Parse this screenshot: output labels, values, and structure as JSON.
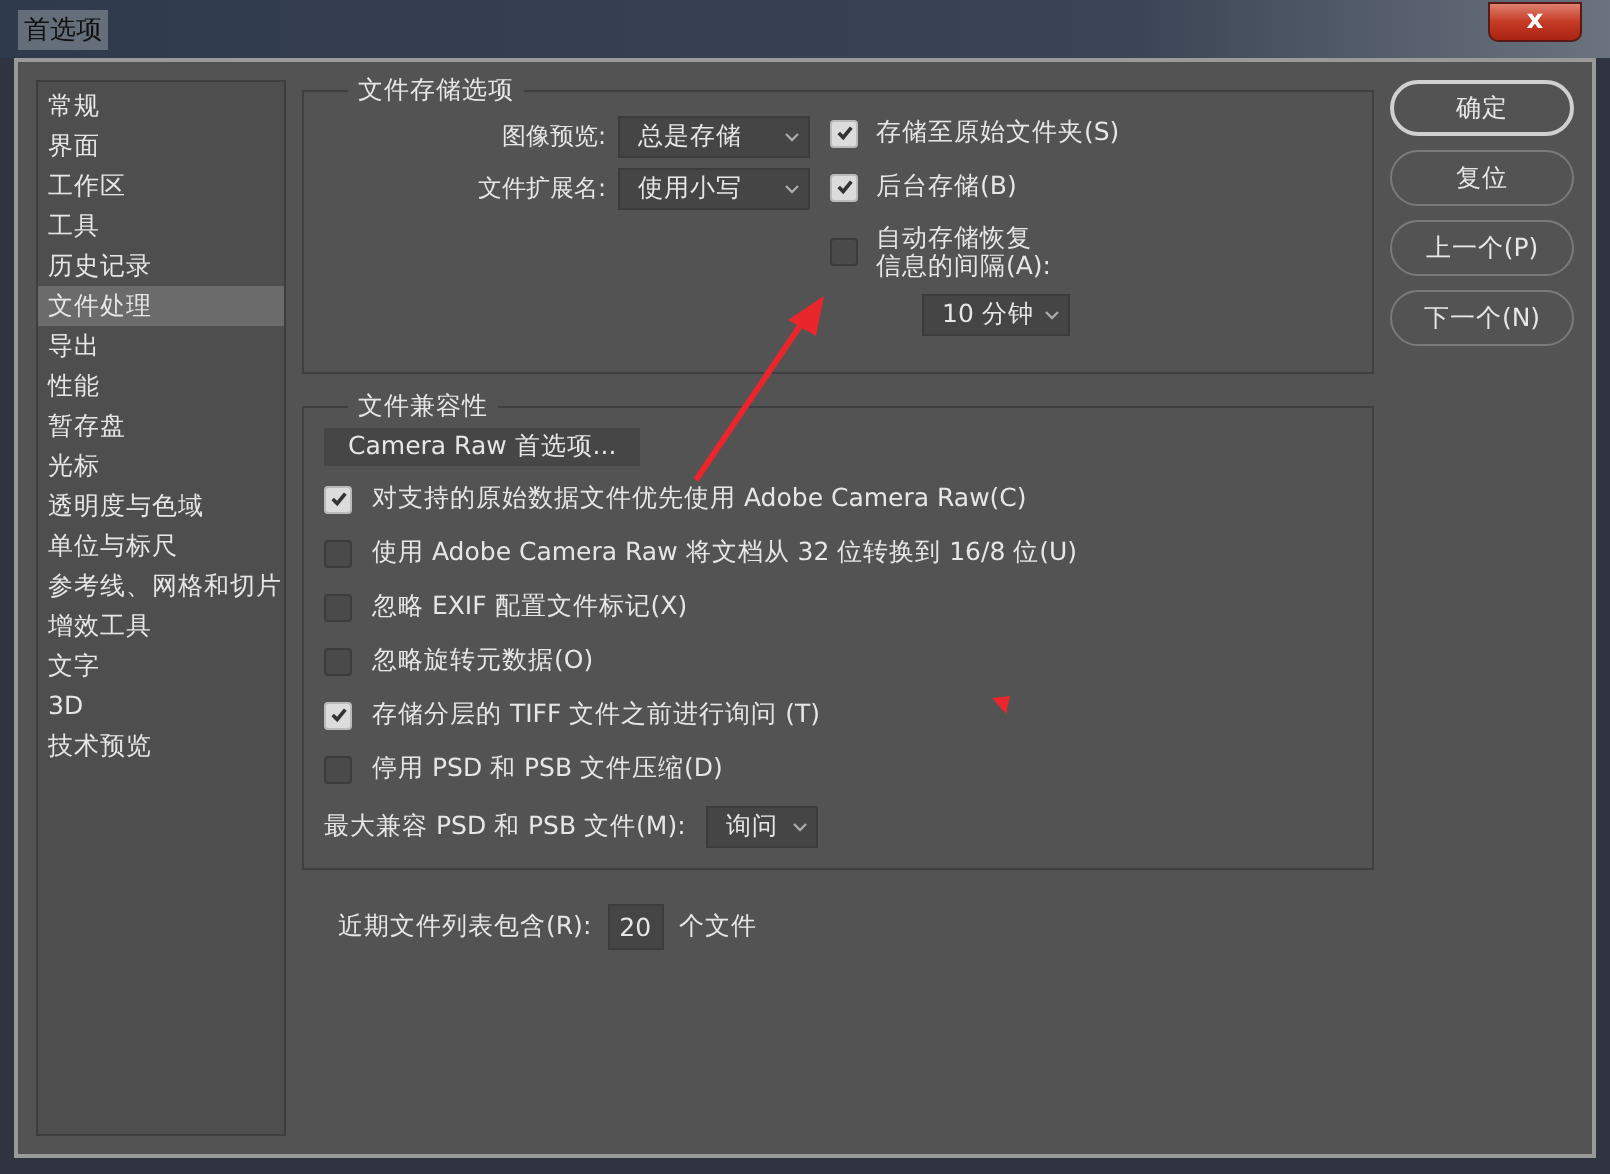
{
  "window": {
    "title": "首选项",
    "close": "x"
  },
  "sidebar": {
    "items": [
      {
        "label": "常规",
        "selected": false
      },
      {
        "label": "界面",
        "selected": false
      },
      {
        "label": "工作区",
        "selected": false
      },
      {
        "label": "工具",
        "selected": false
      },
      {
        "label": "历史记录",
        "selected": false
      },
      {
        "label": "文件处理",
        "selected": true
      },
      {
        "label": "导出",
        "selected": false
      },
      {
        "label": "性能",
        "selected": false
      },
      {
        "label": "暂存盘",
        "selected": false
      },
      {
        "label": "光标",
        "selected": false
      },
      {
        "label": "透明度与色域",
        "selected": false
      },
      {
        "label": "单位与标尺",
        "selected": false
      },
      {
        "label": "参考线、网格和切片",
        "selected": false
      },
      {
        "label": "增效工具",
        "selected": false
      },
      {
        "label": "文字",
        "selected": false
      },
      {
        "label": "3D",
        "selected": false
      },
      {
        "label": "技术预览",
        "selected": false
      }
    ]
  },
  "file_saving": {
    "legend": "文件存储选项",
    "fields": [
      {
        "label": "图像预览:",
        "value": "总是存储"
      },
      {
        "label": "文件扩展名:",
        "value": "使用小写"
      }
    ],
    "checkboxes": [
      {
        "label": "存储至原始文件夹(S)",
        "checked": true
      },
      {
        "label": "后台存储(B)",
        "checked": true
      }
    ],
    "autosave": {
      "lines": [
        "自动存储恢复",
        "信息的间隔(A):"
      ],
      "checked": false,
      "interval": "10 分钟"
    }
  },
  "compatibility": {
    "legend": "文件兼容性",
    "camera_raw_button": "Camera Raw 首选项...",
    "checkboxes": [
      {
        "label": "对支持的原始数据文件优先使用 Adobe Camera Raw(C)",
        "checked": true
      },
      {
        "label": "使用 Adobe Camera Raw 将文档从 32 位转换到 16/8 位(U)",
        "checked": false
      },
      {
        "label": "忽略 EXIF 配置文件标记(X)",
        "checked": false
      },
      {
        "label": "忽略旋转元数据(O)",
        "checked": false
      },
      {
        "label": "存储分层的 TIFF 文件之前进行询问 (T)",
        "checked": true
      },
      {
        "label": "停用 PSD 和 PSB 文件压缩(D)",
        "checked": false
      }
    ],
    "max_compat": {
      "label": "最大兼容 PSD 和 PSB 文件(M):",
      "value": "询问"
    }
  },
  "recent_files": {
    "label": "近期文件列表包含(R):",
    "value": "20",
    "suffix": "个文件"
  },
  "buttons": [
    "确定",
    "复位",
    "上一个(P)",
    "下一个(N)"
  ],
  "arrow_annotation": {
    "color": "#e8262c"
  },
  "triangle_mark": {
    "color": "#e8262c"
  }
}
